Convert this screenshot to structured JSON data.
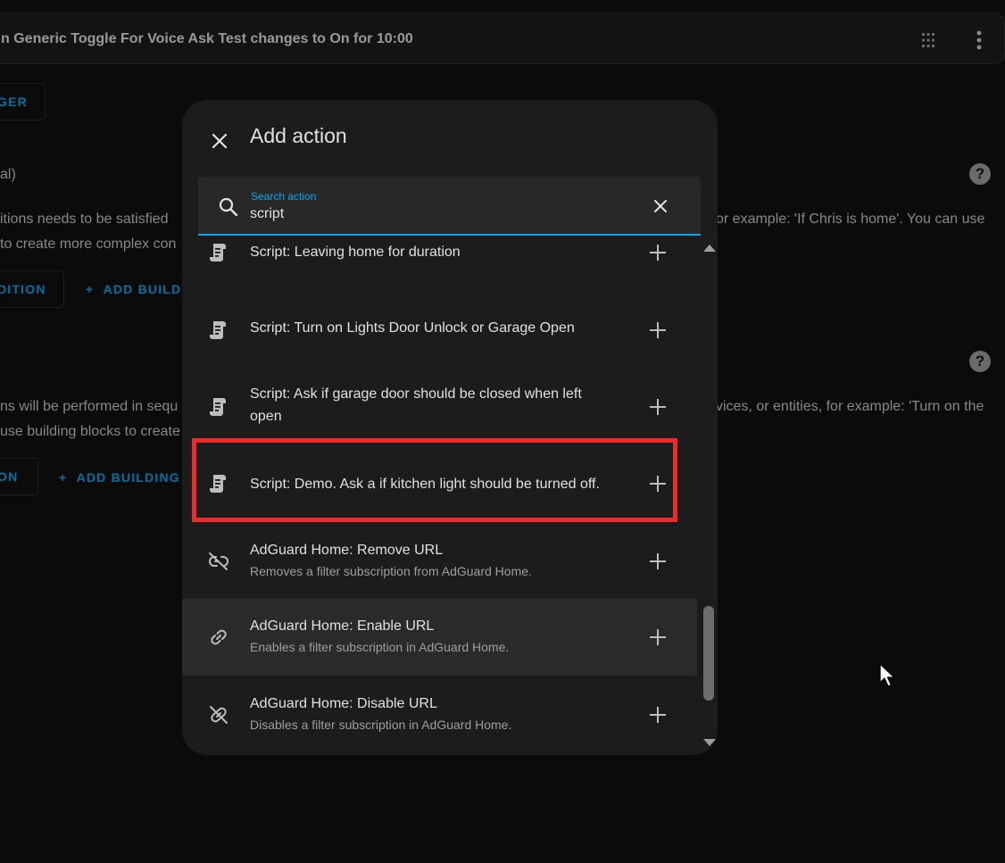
{
  "background": {
    "trigger_title": "n Generic Toggle For Voice Ask Test changes to On for 10:00",
    "trigger_button": "GER",
    "conditions_heading": "al)",
    "conditions_desc_line1_left": "itions needs to be satisfied",
    "conditions_desc_line1_right": "or example: 'If Chris is home'. You can use",
    "conditions_desc_line2_left": "to create more complex con",
    "add_condition_button": "DITION",
    "add_building_block_cond": "ADD BUILD",
    "actions_desc_line1_left": "ns will be performed in sequ",
    "actions_desc_line1_right": "vices, or entities, for example: 'Turn on the",
    "actions_desc_line2_left": "use building blocks to create",
    "add_action_button": "ON",
    "add_building_block_act": "ADD BUILDING"
  },
  "dialog": {
    "title": "Add action",
    "search": {
      "label": "Search action",
      "value": "script"
    },
    "items": [
      {
        "title": "Script: Leaving home for duration",
        "desc": "",
        "icon": "script-icon"
      },
      {
        "title": "Script: Turn on Lights Door Unlock or Garage Open",
        "desc": "",
        "icon": "script-icon"
      },
      {
        "title": "Script: Ask if garage door should be closed when left open",
        "desc": "",
        "icon": "script-icon"
      },
      {
        "title": "Script: Demo. Ask a if kitchen light should be turned off.",
        "desc": "",
        "icon": "script-icon"
      },
      {
        "title": "AdGuard Home: Remove URL",
        "desc": "Removes a filter subscription from AdGuard Home.",
        "icon": "link-off-icon"
      },
      {
        "title": "AdGuard Home: Enable URL",
        "desc": "Enables a filter subscription in AdGuard Home.",
        "icon": "link-icon"
      },
      {
        "title": "AdGuard Home: Disable URL",
        "desc": "Disables a filter subscription in AdGuard Home.",
        "icon": "link-off-icon"
      }
    ]
  },
  "colors": {
    "accent": "#03a9f4",
    "highlight": "#ee2b2b",
    "dialog_bg": "#1c1c1c",
    "page_bg": "#111111"
  }
}
